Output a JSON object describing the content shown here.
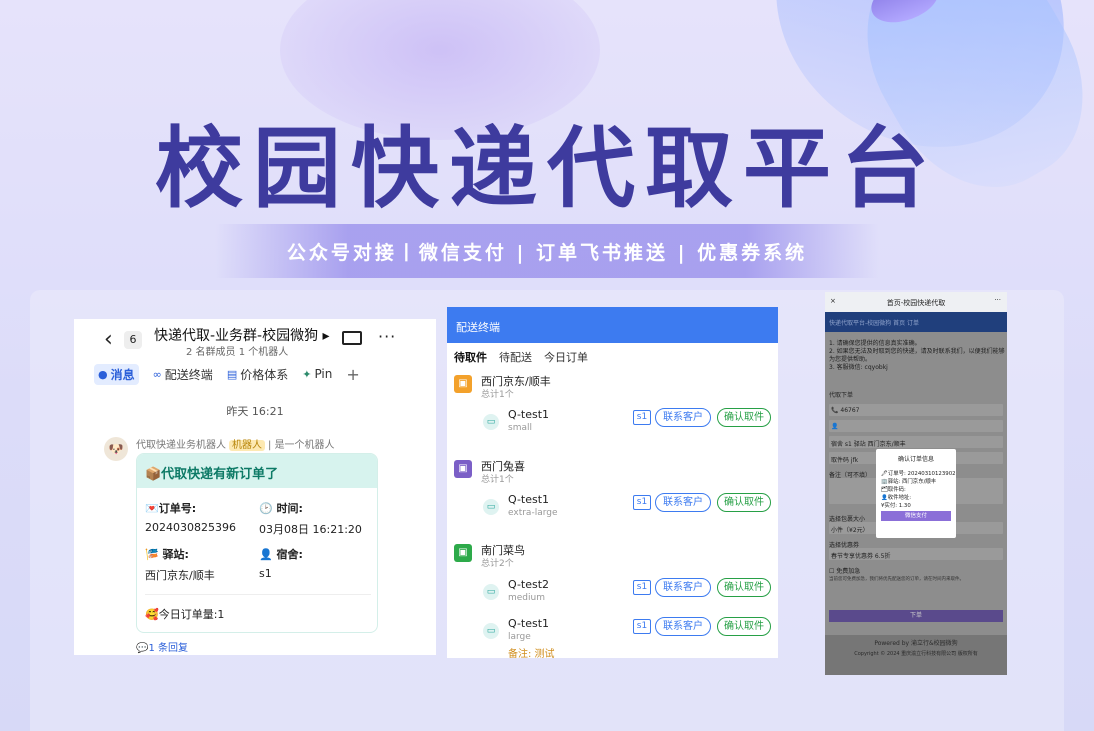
{
  "hero": {
    "title": "校园快递代取平台",
    "subtitle": "公众号对接丨微信支付 | 订单飞书推送 | 优惠券系统"
  },
  "chat": {
    "back_count": "6",
    "group_title": "快递代取-业务群-校园微狗 ▸",
    "group_meta": "2 名群成员   1 个机器人",
    "tabs": [
      {
        "label": "消息",
        "icon": "chat-icon"
      },
      {
        "label": "配送终端",
        "icon": "link-icon"
      },
      {
        "label": "价格体系",
        "icon": "doc-icon"
      },
      {
        "label": "Pin",
        "icon": "pin-icon"
      }
    ],
    "time": "昨天 16:21",
    "sender_name": "代取快递业务机器人",
    "bot_badge": "机器人",
    "sender_note": "是一个机器人",
    "card": {
      "header": "📦代取快递有新订单了",
      "order_label": "💌订单号:",
      "order_value": "2024030825396",
      "time_label": "🕑 时间:",
      "time_value": "03月08日 16:21:20",
      "station_label": "🎏 驿站:",
      "station_value": "西门京东/顺丰",
      "dorm_label": "👤 宿舍:",
      "dorm_value": "s1",
      "daily": "🥰今日订单量:1"
    },
    "reply": "💬1 条回复"
  },
  "delivery": {
    "header": "配送终端",
    "tabs": [
      "待取件",
      "待配送",
      "今日订单"
    ],
    "contact_label": "联系客户",
    "confirm_label": "确认取件",
    "note_label": "备注: 测试",
    "stations": [
      {
        "name": "西门京东/顺丰",
        "count": "总计1个",
        "color": "#f3a12b",
        "items": [
          {
            "name": "Q-test1",
            "size": "small",
            "tag": "s1"
          }
        ]
      },
      {
        "name": "西门兔喜",
        "count": "总计1个",
        "color": "#7b5fc7",
        "items": [
          {
            "name": "Q-test1",
            "size": "extra-large",
            "tag": "s1"
          }
        ]
      },
      {
        "name": "南门菜鸟",
        "count": "总计2个",
        "color": "#2daa4a",
        "items": [
          {
            "name": "Q-test2",
            "size": "medium",
            "tag": "s1"
          },
          {
            "name": "Q-test1",
            "size": "large",
            "tag": "s1"
          }
        ]
      }
    ]
  },
  "mini": {
    "title": "首页-校园快递代取",
    "close": "×",
    "more": "···",
    "nav": "快递代取平台-校园微狗    首页    订单",
    "notice": [
      "1. 请确保您提供的信息真实准确。",
      "2. 如果您无法及时取到您的快递，请及时联系我们，以便我们能够",
      "为您提供帮助。",
      "3. 客服微信: cqyobkj"
    ],
    "section": "代取下单",
    "phone": "📞 46767",
    "person": "👤",
    "station_row": "宿舍  s1          驿站  西门京东/顺丰",
    "code_row": "取件码  jfk",
    "remark": "备注（可不填）",
    "size_label": "选择包裹大小",
    "size_value": "小件（¥2元）",
    "coupon_label": "选择优惠券",
    "coupon_value": "春节专享优惠券 6.5折",
    "free_label": "免费加急",
    "free_note": "当前您可免费加急，我们将优先配送您的订单，请在时间内来取件。",
    "submit": "下单",
    "footer1": "Powered by 渝立行&校园微狗",
    "footer2": "Copyright © 2024 重庆渝立行科技有限公司 版权所有",
    "modal": {
      "title": "确认订单信息",
      "order": "🖋订单号: 20240310123902",
      "station": "🏢驿站: 西门京东/顺丰",
      "code": "🗂取件码: ",
      "receiver": "👤收件地址: ",
      "price": "¥实付: 1.30",
      "pay": "微信支付"
    }
  }
}
